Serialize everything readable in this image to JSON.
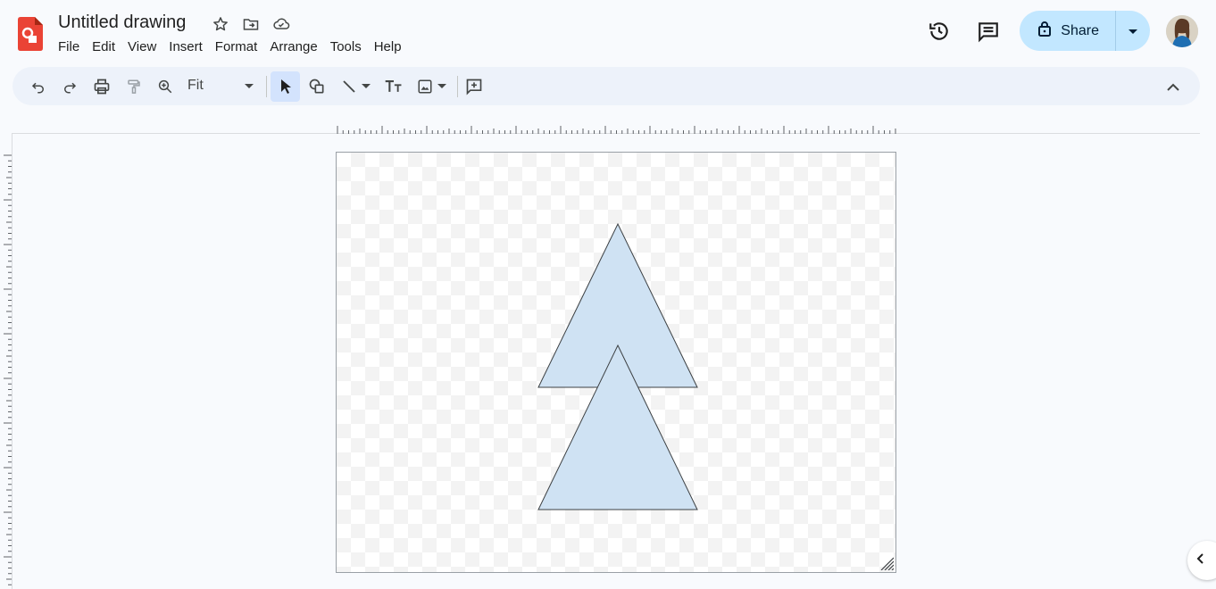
{
  "app": {
    "title": "Untitled drawing",
    "icons": [
      "star-icon",
      "move-to-folder-icon",
      "cloud-saved-icon"
    ]
  },
  "menu": [
    "File",
    "Edit",
    "View",
    "Insert",
    "Format",
    "Arrange",
    "Tools",
    "Help"
  ],
  "header": {
    "share_label": "Share",
    "icons": [
      "version-history-icon",
      "comments-icon",
      "lock-icon",
      "dropdown-icon",
      "avatar"
    ]
  },
  "toolbar": {
    "zoom_value": "Fit",
    "buttons": [
      "undo-icon",
      "redo-icon",
      "print-icon",
      "paint-format-icon",
      "zoom-icon",
      "select-icon",
      "shape-icon",
      "line-icon",
      "text-box-icon",
      "image-icon",
      "add-comment-icon",
      "collapse-icon"
    ]
  },
  "canvas": {
    "shapes": [
      {
        "type": "triangle",
        "fill": "#cfe2f3",
        "stroke": "#3c4043"
      },
      {
        "type": "triangle",
        "fill": "#cfe2f3",
        "stroke": "#3c4043"
      }
    ]
  },
  "colors": {
    "accent": "#c2e7ff",
    "logo": "#ea4335",
    "shape_fill": "#cfe2f3"
  }
}
